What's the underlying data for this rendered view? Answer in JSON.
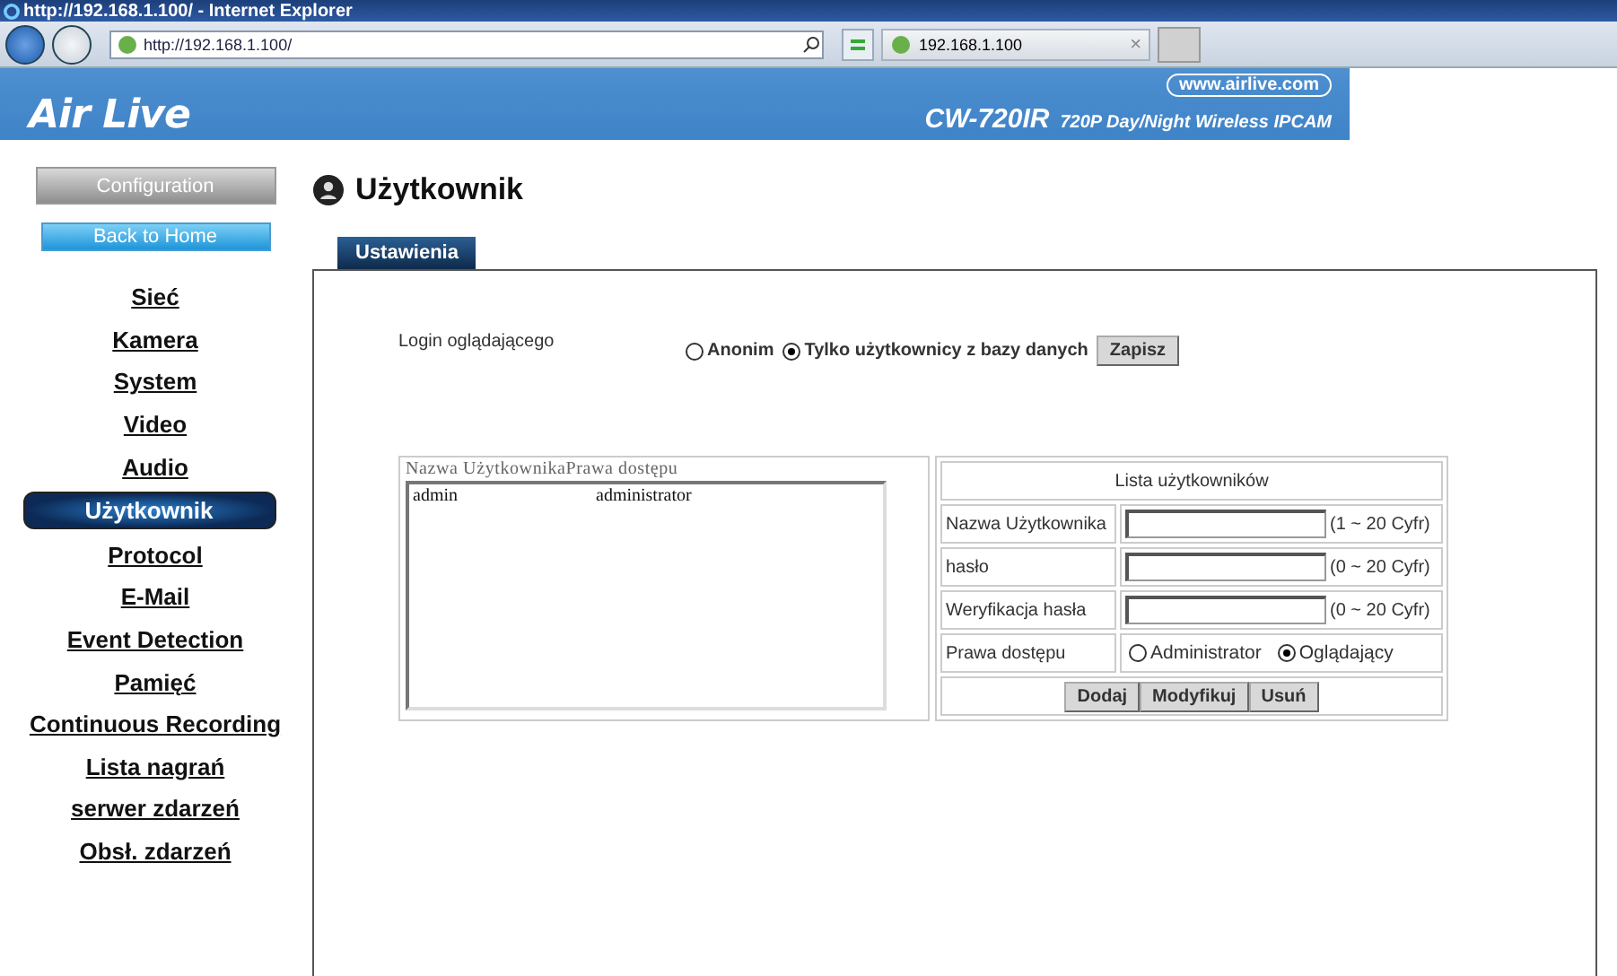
{
  "browser": {
    "title": "http://192.168.1.100/ - Internet Explorer",
    "address": "http://192.168.1.100/",
    "tab_title": "192.168.1.100",
    "tab_close": "×"
  },
  "banner": {
    "logo": "Air Live",
    "url": "www.airlive.com",
    "model": "CW-720IR",
    "subtitle": "720P Day/Night Wireless IPCAM"
  },
  "sidebar": {
    "config_button": "Configuration",
    "home_button": "Back to Home",
    "items": [
      {
        "label": "Sieć",
        "selected": false
      },
      {
        "label": "Kamera",
        "selected": false
      },
      {
        "label": "System",
        "selected": false
      },
      {
        "label": "Video",
        "selected": false
      },
      {
        "label": "Audio",
        "selected": false
      },
      {
        "label": "Użytkownik",
        "selected": true
      },
      {
        "label": "Protocol",
        "selected": false
      },
      {
        "label": "E-Mail",
        "selected": false
      },
      {
        "label": "Event Detection",
        "selected": false
      },
      {
        "label": "Pamięć",
        "selected": false
      },
      {
        "label": "Continuous Recording",
        "selected": false
      },
      {
        "label": "Lista nagrań",
        "selected": false
      },
      {
        "label": "serwer zdarzeń",
        "selected": false
      },
      {
        "label": "Obsł. zdarzeń",
        "selected": false
      }
    ]
  },
  "page": {
    "title": "Użytkownik",
    "tabs": [
      {
        "label": "Ustawienia",
        "selected": true
      }
    ],
    "login": {
      "label": "Login oglądającego",
      "options": [
        {
          "label": "Anonim",
          "selected": false
        },
        {
          "label": "Tylko użytkownicy z bazy danych",
          "selected": true
        }
      ],
      "save_button": "Zapisz"
    },
    "user_list": {
      "header": "Nazwa UżytkownikaPrawa dostępu",
      "rows": [
        {
          "name": "admin",
          "role": "administrator"
        }
      ]
    },
    "form": {
      "title": "Lista użytkowników",
      "fields": [
        {
          "label": "Nazwa Użytkownika",
          "hint": "(1 ~ 20 Cyfr)"
        },
        {
          "label": "hasło",
          "hint": "(0 ~ 20 Cyfr)"
        },
        {
          "label": "Weryfikacja hasła",
          "hint": "(0 ~ 20 Cyfr)"
        }
      ],
      "access": {
        "label": "Prawa dostępu",
        "options": [
          {
            "label": "Administrator",
            "selected": false
          },
          {
            "label": "Oglądający",
            "selected": true
          }
        ]
      },
      "buttons": [
        "Dodaj",
        "Modyfikuj",
        "Usuń"
      ]
    }
  }
}
